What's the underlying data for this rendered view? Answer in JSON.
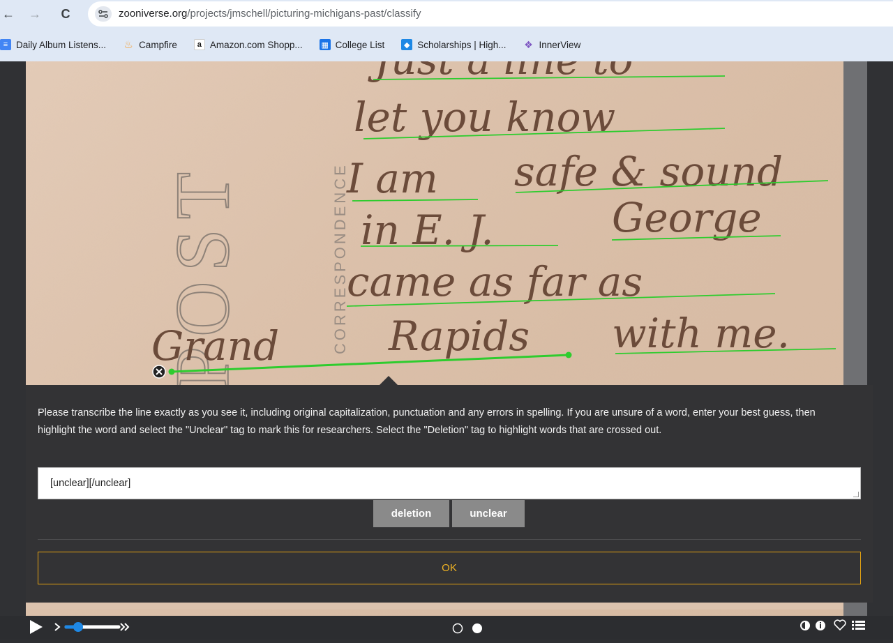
{
  "browser": {
    "back_icon": "←",
    "forward_icon": "→",
    "reload_icon": "C",
    "url_domain": "zooniverse.org",
    "url_path": "/projects/jmschell/picturing-michigans-past/classify"
  },
  "bookmarks": [
    {
      "label": "Daily Album Listens...",
      "icon": "doc-icon",
      "color": "#4285f4",
      "glyph": "≡"
    },
    {
      "label": "Campfire",
      "icon": "flame-icon",
      "color": "#f4a13a",
      "glyph": "♨"
    },
    {
      "label": "Amazon.com Shopp...",
      "icon": "amazon-icon",
      "color": "#111111",
      "glyph": "a"
    },
    {
      "label": "College List",
      "icon": "table-icon",
      "color": "#1a73e8",
      "glyph": "▦"
    },
    {
      "label": "Scholarships | High...",
      "icon": "diamond-icon",
      "color": "#1e88e5",
      "glyph": "◆"
    },
    {
      "label": "InnerView",
      "icon": "heart-icon",
      "color": "#7e57c2",
      "glyph": "❖"
    }
  ],
  "postcard": {
    "stamp_text": "POST",
    "correspondence_text": "CORRESPONDENCE",
    "handwriting": [
      "Just a line to",
      "let you know",
      "I am",
      "safe & sound",
      "in E. J.",
      "George",
      "came as far as",
      "Grand",
      "Rapids",
      "with me."
    ]
  },
  "popup": {
    "instructions": "Please transcribe the line exactly as you see it, including original capitalization, punctuation and any errors in spelling. If you are unsure of a word, enter your best guess, then highlight the word and select the \"Unclear\" tag to mark this for researchers. Select the \"Deletion\" tag to highlight words that are crossed out.",
    "transcription_value": "[unclear][/unclear]",
    "deletion_label": "deletion",
    "unclear_label": "unclear",
    "ok_label": "OK"
  },
  "colors": {
    "accent_ok": "#f0b323",
    "line_green": "#2ecc2e"
  }
}
